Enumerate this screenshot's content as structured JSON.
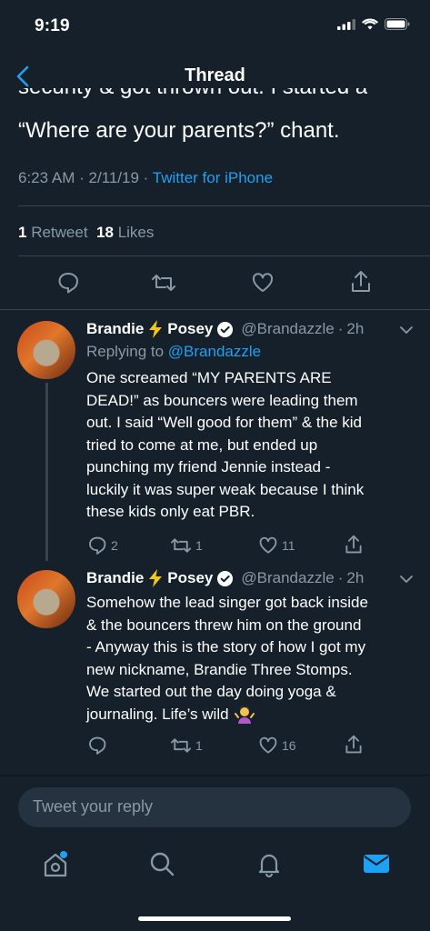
{
  "status_bar": {
    "time": "9:19"
  },
  "header": {
    "title": "Thread"
  },
  "main_tweet": {
    "cut_line": "security & got thrown out. I started a",
    "text_line": "“Where are your parents?” chant.",
    "time": "6:23 AM",
    "date": "2/11/19",
    "source": "Twitter for iPhone",
    "retweets": "1",
    "retweets_label": "Retweet",
    "likes": "18",
    "likes_label": "Likes"
  },
  "replies": [
    {
      "name_first": "Brandie",
      "name_last": "Posey",
      "handle": "@Brandazzle",
      "time": "2h",
      "replying_label": "Replying to",
      "replying_handle": "@Brandazzle",
      "text_lines": [
        "One screamed “MY PARENTS ARE",
        "DEAD!” as bouncers were leading them",
        "out. I said “Well good for them” & the kid",
        "tried to come at me, but ended up",
        "punching my friend Jennie instead -",
        "luckily it was super weak because I think",
        "these kids only eat PBR."
      ],
      "reply_count": "2",
      "retweet_count": "1",
      "like_count": "11"
    },
    {
      "name_first": "Brandie",
      "name_last": "Posey",
      "handle": "@Brandazzle",
      "time": "2h",
      "text_lines": [
        "Somehow the lead singer got back inside",
        "& the bouncers threw him on the ground",
        "- Anyway this is the story of how I got my",
        "new nickname, Brandie Three Stomps.",
        "We started out the day doing yoga &",
        "journaling. Life’s wild"
      ],
      "reply_count": "",
      "retweet_count": "1",
      "like_count": "16"
    }
  ],
  "composer": {
    "placeholder": "Tweet your reply"
  },
  "tab_bar": {
    "items": [
      "home-icon",
      "search-icon",
      "notifications-icon",
      "messages-icon"
    ]
  },
  "colors": {
    "background": "#15202b",
    "accent": "#1da1f2",
    "muted": "#8899a6",
    "divider": "#38444d"
  }
}
